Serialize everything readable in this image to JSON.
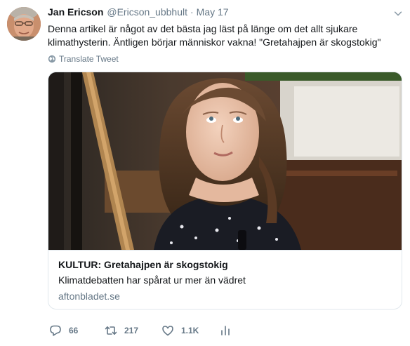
{
  "tweet": {
    "author_name": "Jan Ericson",
    "author_handle": "@Ericson_ubbhult",
    "separator": "·",
    "date": "May 17",
    "text_lines": [
      "Denna artikel är något av det bästa jag läst på länge om det allt sjukare",
      "klimathysterin. Äntligen börjar människor vakna! \"Gretahajpen är skogstokig\""
    ],
    "translate_label": "Translate Tweet"
  },
  "card": {
    "title": "KULTUR: Gretahajpen är skogstokig",
    "description": "Klimatdebatten har spårat ur mer än vädret",
    "domain": "aftonbladet.se"
  },
  "actions": {
    "reply_count": "66",
    "retweet_count": "217",
    "like_count": "1.1K"
  },
  "icons": {
    "reply": "reply-icon",
    "retweet": "retweet-icon",
    "like": "heart-icon",
    "analytics": "analytics-icon",
    "globe": "globe-icon",
    "caret": "chevron-down-icon"
  },
  "colors": {
    "text": "#14171a",
    "secondary": "#657786",
    "border": "#e1e8ed"
  }
}
